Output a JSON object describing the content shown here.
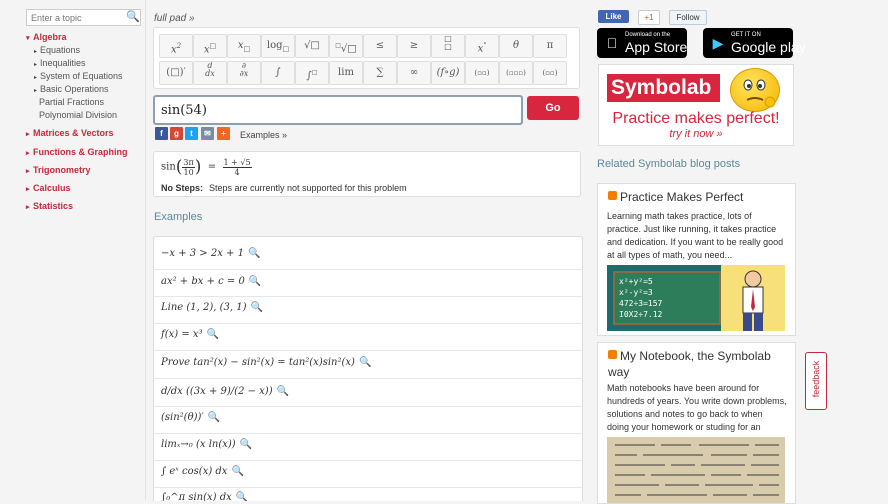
{
  "sidebar": {
    "search_placeholder": "Enter a topic",
    "categories": [
      {
        "label": "Algebra",
        "expanded": true
      },
      {
        "label": "Matrices & Vectors",
        "expanded": false
      },
      {
        "label": "Functions & Graphing",
        "expanded": false
      },
      {
        "label": "Trigonometry",
        "expanded": false
      },
      {
        "label": "Calculus",
        "expanded": false
      },
      {
        "label": "Statistics",
        "expanded": false
      }
    ],
    "algebra_items": [
      "Equations",
      "Inequalities",
      "System of Equations",
      "Basic Operations",
      "Partial Fractions",
      "Polynomial Division"
    ]
  },
  "keypad": {
    "full_pad_label": "full pad »"
  },
  "query": {
    "value": "sin(54)",
    "go_label": "Go"
  },
  "share": {
    "examples_link": "Examples »"
  },
  "result": {
    "lhs_func": "sin",
    "lhs_num": "3π",
    "lhs_den": "10",
    "equals": "=",
    "rhs_num": "1 + √5",
    "rhs_den": "4",
    "no_steps_label": "No Steps:",
    "no_steps_text": "Steps are currently not supported for this problem"
  },
  "examples": {
    "heading": "Examples",
    "items": [
      "−x + 3 > 2x + 1",
      "ax² + bx + c = 0",
      "Line (1, 2), (3, 1)",
      "f(x) = x³",
      "Prove tan²(x) − sin²(x) = tan²(x)sin²(x)",
      "d/dx ((3x + 9)/(2 − x))",
      "(sin²(θ))′",
      "limₓ→₀ (x ln(x))",
      "∫ eˣ cos(x) dx",
      "∫₀^π sin(x) dx"
    ]
  },
  "social": {
    "fb_like": "Like",
    "gplus": "+1",
    "tw_follow": "Follow"
  },
  "stores": {
    "apple_small": "Download on the",
    "apple_big": "App Store",
    "google_small": "GET IT ON",
    "google_big": "Google play"
  },
  "ad": {
    "logo": "Symbolab",
    "tagline": "Practice makes perfect!",
    "cta": "try it now »"
  },
  "blog": {
    "heading": "Related Symbolab blog posts",
    "posts": [
      {
        "title": "Practice Makes Perfect",
        "text": "Learning math takes practice, lots of practice.  Just like running, it takes practice and dedication.    If you want to be really good at all types of math, you need...",
        "image_lines": [
          "x²+y²=5",
          "x²-y²=3",
          "472÷3=157",
          "I0X2÷7.12"
        ]
      },
      {
        "title": "My Notebook, the Symbolab way",
        "text": "Math notebooks have been around for hundreds of years.  You write down problems, solutions and notes to go back to when doing your homework or studing  for an exam.  ..."
      }
    ]
  },
  "feedback": {
    "label": "feedback"
  },
  "colors": {
    "accent_red": "#d7263d",
    "link_teal": "#5a8a9a",
    "panel_bg": "#f4f4f4"
  }
}
